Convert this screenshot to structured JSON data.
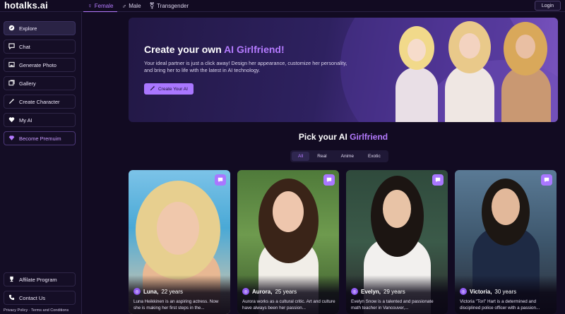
{
  "app": {
    "logo": "hotalks.ai"
  },
  "topbar": {
    "gender_tabs": [
      {
        "label": "Female",
        "icon": "female-icon",
        "active": true
      },
      {
        "label": "Male",
        "icon": "male-icon",
        "active": false
      },
      {
        "label": "Transgender",
        "icon": "transgender-icon",
        "active": false
      }
    ],
    "login_label": "Login"
  },
  "sidebar": {
    "items": [
      {
        "label": "Explore",
        "icon": "compass-icon"
      },
      {
        "label": "Chat",
        "icon": "chat-icon"
      },
      {
        "label": "Generate Photo",
        "icon": "image-icon"
      },
      {
        "label": "Gallery",
        "icon": "gallery-icon"
      },
      {
        "label": "Create Character",
        "icon": "wand-icon"
      },
      {
        "label": "My AI",
        "icon": "heart-icon"
      },
      {
        "label": "Become Premuim",
        "icon": "diamond-icon"
      }
    ],
    "bottom_items": [
      {
        "label": "Affilate Program",
        "icon": "trophy-icon"
      },
      {
        "label": "Contact Us",
        "icon": "phone-icon"
      }
    ],
    "footer_links": "Privacy Policy · Terms and Conditions"
  },
  "hero": {
    "title_prefix": "Create your own ",
    "title_accent": "AI Girlfriend!",
    "text": "Your ideal partner is just a click away! Design her appearance, customize her personality, and bring her to life with the latest in AI technology.",
    "button_label": "Create Your AI"
  },
  "pick": {
    "title_prefix": "Pick your AI ",
    "title_accent": "Girlfriend",
    "filters": [
      "All",
      "Real",
      "Anime",
      "Exotic"
    ]
  },
  "cards": [
    {
      "name": "Luna,",
      "age": "22 years",
      "desc": "Luna Heikkinen is an aspiring actress. Now she is making her first steps in the..."
    },
    {
      "name": "Aurora,",
      "age": "25 years",
      "desc": "Aurora works as a cultural critic. Art and culture have always been her passion..."
    },
    {
      "name": "Evelyn,",
      "age": "29 years",
      "desc": "Evelyn Snow is a talented and passionate math teacher in Vancouver,..."
    },
    {
      "name": "Victoria,",
      "age": "30 years",
      "desc": "Victoria \"Tori\" Hart is a determined and disciplined police officer with a passion..."
    }
  ],
  "colors": {
    "accent": "#b57bff",
    "button": "#a977ff",
    "background": "#120b22"
  }
}
